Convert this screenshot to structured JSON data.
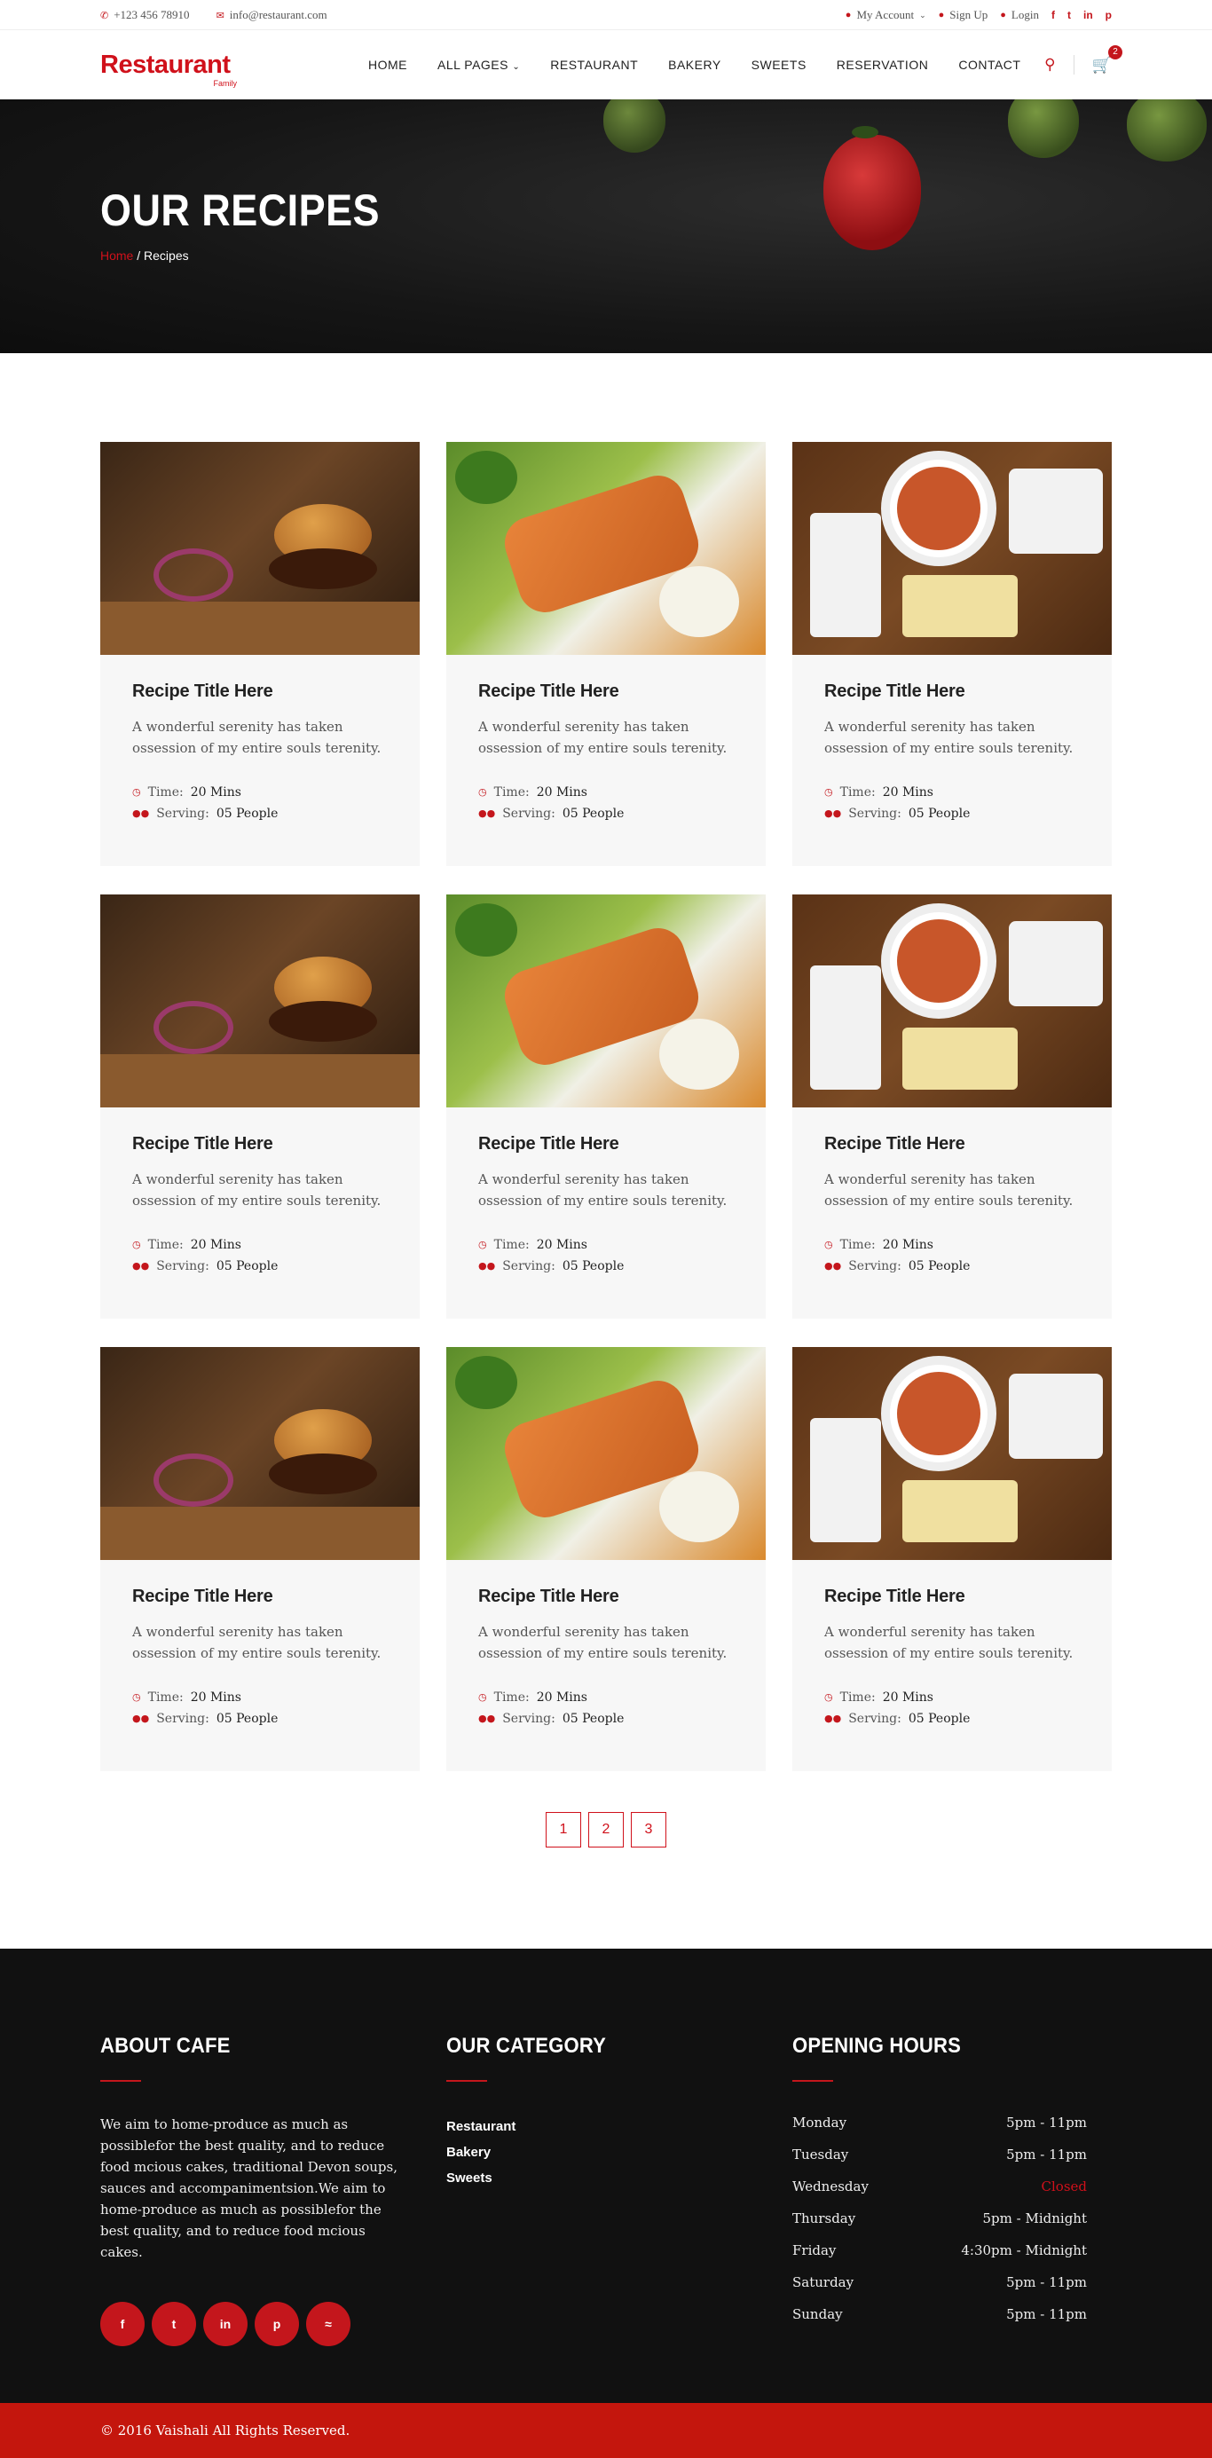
{
  "topbar": {
    "phone": "+123 456 78910",
    "email": "info@restaurant.com",
    "account": "My Account",
    "signup": "Sign Up",
    "login": "Login"
  },
  "header": {
    "logo_name": "Restaurant",
    "logo_sub": "Family",
    "nav": [
      "HOME",
      "ALL PAGES",
      "RESTAURANT",
      "BAKERY",
      "SWEETS",
      "RESERVATION",
      "CONTACT"
    ],
    "cart_count": "2"
  },
  "hero": {
    "title": "OUR RECIPES",
    "crumb_home": "Home",
    "crumb_current": "/ Recipes"
  },
  "recipes": [
    {
      "title": "Recipe Title Here",
      "desc": "A wonderful serenity has taken ossession of my entire souls terenity.",
      "time_label": "Time:",
      "time": "20 Mins",
      "serving_label": "Serving:",
      "serving": "05 People",
      "image": "burger"
    },
    {
      "title": "Recipe Title Here",
      "desc": "A wonderful serenity has taken ossession of my entire souls terenity.",
      "time_label": "Time:",
      "time": "20 Mins",
      "serving_label": "Serving:",
      "serving": "05 People",
      "image": "salmon"
    },
    {
      "title": "Recipe Title Here",
      "desc": "A wonderful serenity has taken ossession of my entire souls terenity.",
      "time_label": "Time:",
      "time": "20 Mins",
      "serving_label": "Serving:",
      "serving": "05 People",
      "image": "bowls"
    },
    {
      "title": "Recipe Title Here",
      "desc": "A wonderful serenity has taken ossession of my entire souls terenity.",
      "time_label": "Time:",
      "time": "20 Mins",
      "serving_label": "Serving:",
      "serving": "05 People",
      "image": "burger"
    },
    {
      "title": "Recipe Title Here",
      "desc": "A wonderful serenity has taken ossession of my entire souls terenity.",
      "time_label": "Time:",
      "time": "20 Mins",
      "serving_label": "Serving:",
      "serving": "05 People",
      "image": "salmon"
    },
    {
      "title": "Recipe Title Here",
      "desc": "A wonderful serenity has taken ossession of my entire souls terenity.",
      "time_label": "Time:",
      "time": "20 Mins",
      "serving_label": "Serving:",
      "serving": "05 People",
      "image": "bowls"
    },
    {
      "title": "Recipe Title Here",
      "desc": "A wonderful serenity has taken ossession of my entire souls terenity.",
      "time_label": "Time:",
      "time": "20 Mins",
      "serving_label": "Serving:",
      "serving": "05 People",
      "image": "burger"
    },
    {
      "title": "Recipe Title Here",
      "desc": "A wonderful serenity has taken ossession of my entire souls terenity.",
      "time_label": "Time:",
      "time": "20 Mins",
      "serving_label": "Serving:",
      "serving": "05 People",
      "image": "salmon"
    },
    {
      "title": "Recipe Title Here",
      "desc": "A wonderful serenity has taken ossession of my entire souls terenity.",
      "time_label": "Time:",
      "time": "20 Mins",
      "serving_label": "Serving:",
      "serving": "05 People",
      "image": "bowls"
    }
  ],
  "pagination": [
    "1",
    "2",
    "3"
  ],
  "footer": {
    "about_title": "ABOUT CAFE",
    "about_text": "We aim to home-produce as much as possiblefor the best quality, and to reduce food mcious cakes, traditional Devon soups, sauces and accompanimentsion.We aim to home-produce as much as possiblefor the best quality, and to reduce food mcious cakes.",
    "category_title": "OUR CATEGORY",
    "categories": [
      "Restaurant",
      "Bakery",
      "Sweets"
    ],
    "hours_title": "OPENING HOURS",
    "hours": [
      {
        "day": "Monday",
        "time": "5pm - 11pm"
      },
      {
        "day": "Tuesday",
        "time": "5pm - 11pm"
      },
      {
        "day": "Wednesday",
        "time": "Closed"
      },
      {
        "day": "Thursday",
        "time": "5pm - Midnight"
      },
      {
        "day": "Friday",
        "time": "4:30pm - Midnight"
      },
      {
        "day": "Saturday",
        "time": "5pm - 11pm"
      },
      {
        "day": "Sunday",
        "time": "5pm - 11pm"
      }
    ],
    "socials": [
      "facebook-icon",
      "twitter-icon",
      "linkedin-icon",
      "pinterest-icon",
      "rss-icon"
    ],
    "copyright": "© 2016 Vaishali All Rights Reserved."
  },
  "colors": {
    "accent": "#c4161c",
    "footer_bg": "#111111",
    "card_bg": "#f7f7f7"
  }
}
